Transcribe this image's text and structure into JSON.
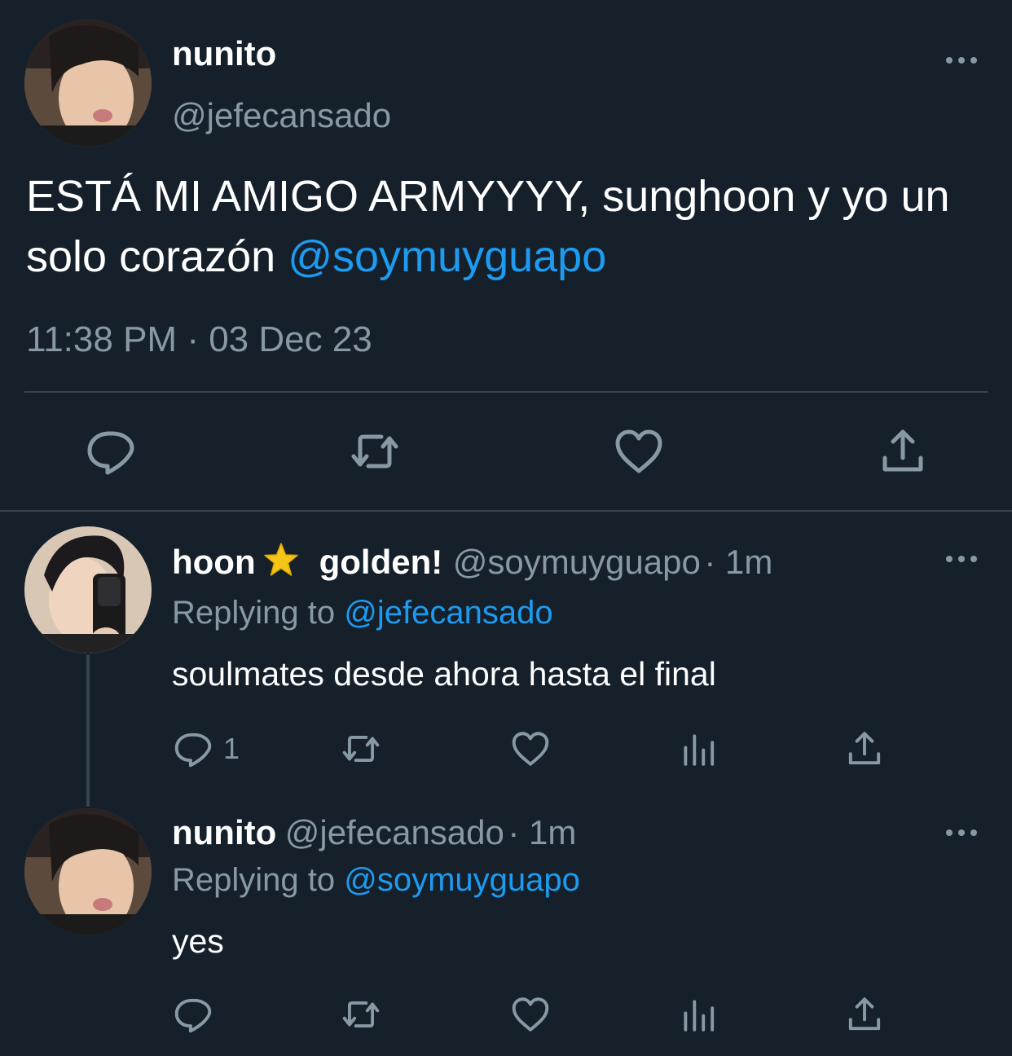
{
  "main_tweet": {
    "display_name": "nunito",
    "handle": "@jefecansado",
    "text": "ESTÁ MI AMIGO ARMYYYY, sunghoon y yo un solo corazón",
    "mention": "@soymuyguapo",
    "time": "11:38 PM",
    "separator": "·",
    "date": "03 Dec 23",
    "more_icon": "more-horizontal-icon",
    "actions": [
      "reply-icon",
      "retweet-icon",
      "like-icon",
      "share-icon"
    ]
  },
  "replies": [
    {
      "display_name": "hoon",
      "name_emoji": "star",
      "display_name_suffix": "golden!",
      "handle": "@soymuyguapo",
      "time": "· 1m",
      "replying_prefix": "Replying to",
      "replying_to": "@jefecansado",
      "text": "soulmates desde ahora hasta el final",
      "reply_count": "1"
    },
    {
      "display_name": "nunito",
      "handle": "@jefecansado",
      "time": "· 1m",
      "replying_prefix": "Replying to",
      "replying_to": "@soymuyguapo",
      "text": "yes",
      "reply_count": ""
    }
  ],
  "colors": {
    "background": "#15202b",
    "text": "#ffffff",
    "secondary": "#8899a6",
    "link": "#1d9bf0",
    "divider": "#38444d"
  }
}
